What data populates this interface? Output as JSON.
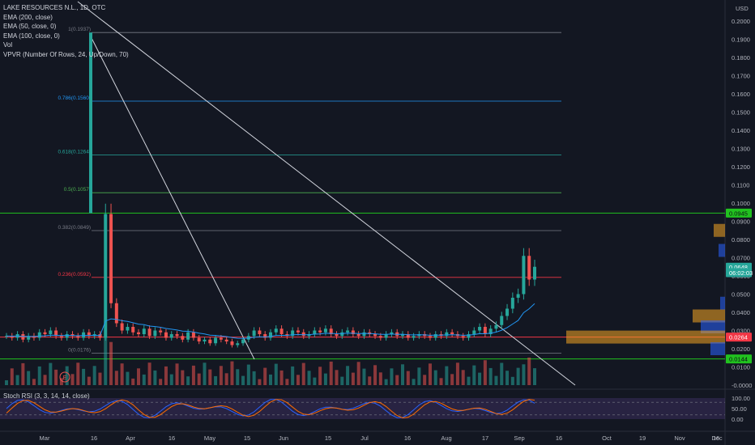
{
  "legend": {
    "symbol": "LAKE RESOURCES N.L., 1D, OTC",
    "indicators": [
      "EMA (200, close)",
      "EMA (50, close, 0)",
      "EMA (100, close, 0)",
      "Vol",
      "VPVR (Number Of Rows, 24, Up/Down, 70)"
    ]
  },
  "stoch_label": "Stoch RSI (3, 3, 14, 14, close)",
  "currency": "USD",
  "price_boxes": [
    {
      "label": "0.0945",
      "value": 0.0945,
      "bg": "#21c21f",
      "fg": "#0b0e14"
    },
    {
      "label": "0.0648",
      "value": 0.0648,
      "bg": "#26a69a",
      "fg": "#ffffff"
    },
    {
      "label": "06:02:03",
      "value": 0.0618,
      "bg": "#26a69a",
      "fg": "#ffffff"
    },
    {
      "label": "0.0264",
      "value": 0.0264,
      "bg": "#f23645",
      "fg": "#ffffff"
    },
    {
      "label": "0.0144",
      "value": 0.0144,
      "bg": "#21c21f",
      "fg": "#0b0e14"
    }
  ],
  "chart_data": {
    "type": "candlestick",
    "x_axis_labels": [
      "Mar",
      "16",
      "Apr",
      "16",
      "May",
      "15",
      "Jun",
      "15",
      "Jul",
      "16",
      "Aug",
      "17",
      "Sep",
      "16",
      "Oct",
      "19",
      "Nov",
      "16",
      "Dec"
    ],
    "y_axis_labels": [
      "0.2000",
      "0.1900",
      "0.1800",
      "0.1700",
      "0.1600",
      "0.1500",
      "0.1400",
      "0.1300",
      "0.1200",
      "0.1100",
      "0.1000",
      "0.0900",
      "0.0800",
      "0.0700",
      "0.0600",
      "0.0500",
      "0.0400",
      "0.0300",
      "0.0200",
      "0.0100",
      "-0.0000"
    ],
    "ylim": [
      0.0,
      0.2
    ],
    "stoch_axis_labels": [
      "100.00",
      "50.00",
      "0.00"
    ],
    "fib_levels": [
      {
        "label": "1(0.1937)",
        "value": 0.1937,
        "color": "#787b86"
      },
      {
        "label": "0.786(0.1560)",
        "value": 0.156,
        "color": "#2196f3"
      },
      {
        "label": "0.618(0.1264)",
        "value": 0.1264,
        "color": "#26a69a"
      },
      {
        "label": "0.5(0.1057)",
        "value": 0.1057,
        "color": "#4caf50"
      },
      {
        "label": "0.382(0.0849)",
        "value": 0.0849,
        "color": "#787b86"
      },
      {
        "label": "0.236(0.0592)",
        "value": 0.0592,
        "color": "#f23645"
      },
      {
        "label": "0(0.0176)",
        "value": 0.0176,
        "color": "#787b86"
      }
    ],
    "horizontal_lines": [
      {
        "value": 0.0945,
        "color": "#21c21f"
      },
      {
        "value": 0.0264,
        "color": "#f23645"
      },
      {
        "value": 0.0144,
        "color": "#21c21f"
      }
    ],
    "series": [
      {
        "name": "close",
        "values": [
          0.027,
          0.026,
          0.028,
          0.025,
          0.027,
          0.026,
          0.029,
          0.028,
          0.03,
          0.027,
          0.026,
          0.028,
          0.027,
          0.026,
          0.029,
          0.027,
          0.028,
          0.026,
          0.094,
          0.045,
          0.034,
          0.03,
          0.032,
          0.029,
          0.028,
          0.031,
          0.027,
          0.03,
          0.029,
          0.026,
          0.028,
          0.027,
          0.025,
          0.029,
          0.026,
          0.024,
          0.025,
          0.023,
          0.026,
          0.025,
          0.024,
          0.022,
          0.023,
          0.025,
          0.027,
          0.03,
          0.028,
          0.026,
          0.029,
          0.031,
          0.028,
          0.027,
          0.03,
          0.029,
          0.027,
          0.028,
          0.03,
          0.029,
          0.031,
          0.028,
          0.027,
          0.029,
          0.03,
          0.028,
          0.027,
          0.029,
          0.028,
          0.027,
          0.026,
          0.028,
          0.029,
          0.027,
          0.028,
          0.026,
          0.027,
          0.028,
          0.027,
          0.026,
          0.028,
          0.027,
          0.029,
          0.028,
          0.027,
          0.026,
          0.028,
          0.03,
          0.032,
          0.028,
          0.031,
          0.033,
          0.038,
          0.042,
          0.048,
          0.05,
          0.071,
          0.058,
          0.065
        ]
      }
    ],
    "volume_profile_row_value": 0.0264
  }
}
